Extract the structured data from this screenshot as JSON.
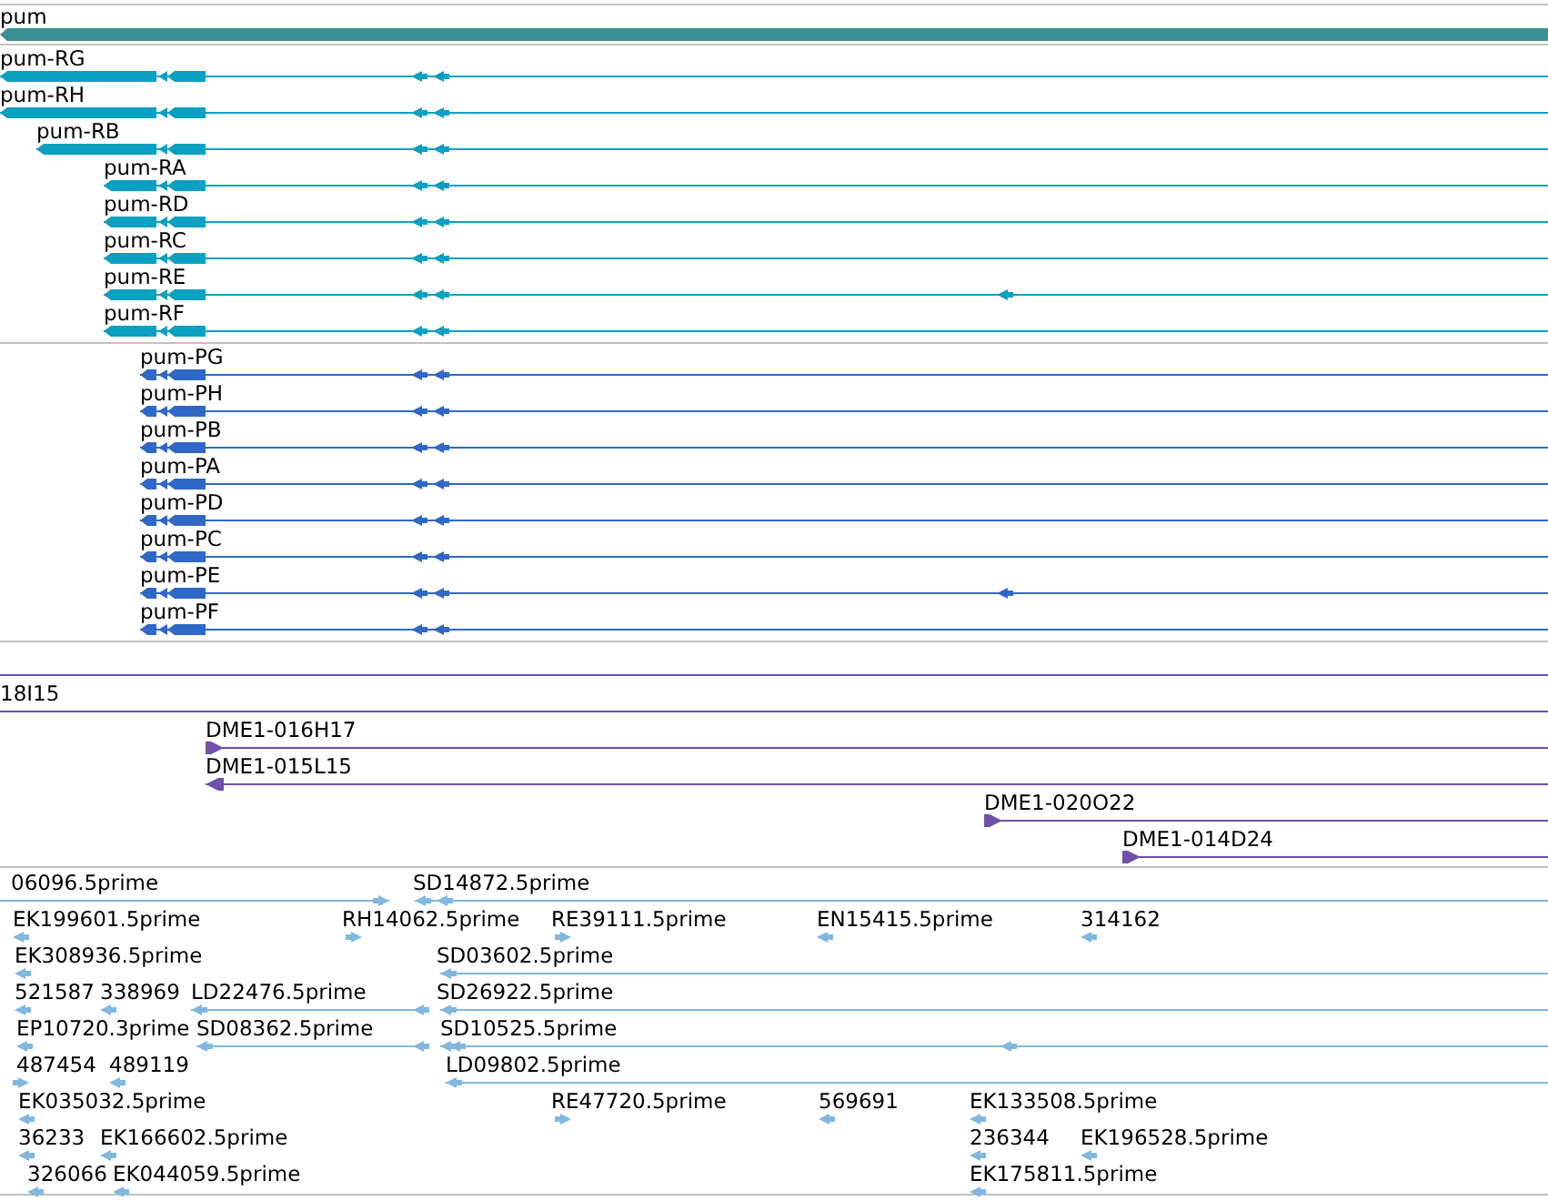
{
  "tracks": [
    {
      "kind": "gene",
      "color": "#3a8f93",
      "features": [
        {
          "label": "pum",
          "reverse": true
        }
      ]
    },
    {
      "kind": "transcripts",
      "color": "#0aa0c2",
      "features": [
        {
          "label": "pum-RG",
          "reverse": true
        },
        {
          "label": "pum-RH",
          "reverse": true
        },
        {
          "label": "pum-RB",
          "reverse": true
        },
        {
          "label": "pum-RA",
          "reverse": true
        },
        {
          "label": "pum-RD",
          "reverse": true
        },
        {
          "label": "pum-RC",
          "reverse": true
        },
        {
          "label": "pum-RE",
          "reverse": true
        },
        {
          "label": "pum-RF",
          "reverse": true
        }
      ]
    },
    {
      "kind": "transcripts",
      "color": "#3068c8",
      "features": [
        {
          "label": "pum-PG",
          "reverse": true
        },
        {
          "label": "pum-PH",
          "reverse": true
        },
        {
          "label": "pum-PB",
          "reverse": true
        },
        {
          "label": "pum-PA",
          "reverse": true
        },
        {
          "label": "pum-PD",
          "reverse": true
        },
        {
          "label": "pum-PC",
          "reverse": true
        },
        {
          "label": "pum-PE",
          "reverse": true
        },
        {
          "label": "pum-PF",
          "reverse": true
        }
      ]
    },
    {
      "kind": "clones",
      "color": "#7050a8",
      "features": [
        {
          "kind": "line"
        },
        {
          "kind": "clone",
          "label": "18I15"
        },
        {
          "kind": "clone",
          "label": "DME1-016H17",
          "reverse": false
        },
        {
          "kind": "clone",
          "label": "DME1-015L15",
          "reverse": true
        },
        {
          "kind": "clone",
          "label": "DME1-020O22",
          "reverse": false
        },
        {
          "kind": "clone",
          "label": "DME1-014D24",
          "reverse": false
        }
      ]
    },
    {
      "kind": "ests",
      "color": "#80b8e0",
      "features": [
        {
          "label": "06096.5prime",
          "reverse": false
        },
        {
          "label": "SD14872.5prime",
          "reverse": true
        },
        {
          "label": "EK199601.5prime",
          "reverse": true
        },
        {
          "label": "RH14062.5prime",
          "reverse": false
        },
        {
          "label": "RE39111.5prime",
          "reverse": false
        },
        {
          "label": "EN15415.5prime",
          "reverse": true
        },
        {
          "label": "314162",
          "reverse": true
        },
        {
          "label": "EK308936.5prime",
          "reverse": true
        },
        {
          "label": "SD03602.5prime",
          "reverse": true
        },
        {
          "label": "521587",
          "reverse": true
        },
        {
          "label": "338969",
          "reverse": true
        },
        {
          "label": "LD22476.5prime",
          "reverse": true
        },
        {
          "label": "SD26922.5prime",
          "reverse": true
        },
        {
          "label": "EP10720.3prime",
          "reverse": true
        },
        {
          "label": "SD08362.5prime",
          "reverse": true
        },
        {
          "label": "SD10525.5prime",
          "reverse": true
        },
        {
          "label": "487454",
          "reverse": false
        },
        {
          "label": "489119",
          "reverse": true
        },
        {
          "label": "LD09802.5prime",
          "reverse": true
        },
        {
          "label": "EK035032.5prime",
          "reverse": true
        },
        {
          "label": "RE47720.5prime",
          "reverse": false
        },
        {
          "label": "569691",
          "reverse": true
        },
        {
          "label": "EK133508.5prime",
          "reverse": true
        },
        {
          "label": "36233",
          "reverse": true
        },
        {
          "label": "EK166602.5prime",
          "reverse": true
        },
        {
          "label": "236344",
          "reverse": true
        },
        {
          "label": "EK196528.5prime",
          "reverse": true
        },
        {
          "label": "326066",
          "reverse": true
        },
        {
          "label": "EK044059.5prime",
          "reverse": true
        },
        {
          "label": "EK175811.5prime",
          "reverse": true
        }
      ]
    }
  ]
}
